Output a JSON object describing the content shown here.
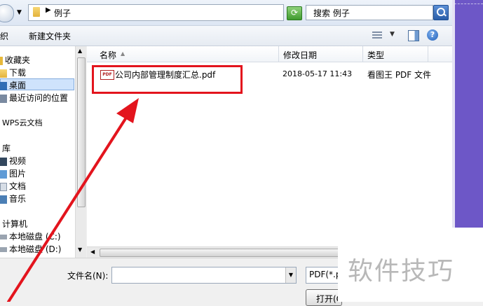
{
  "address": {
    "crumb": "例子",
    "search_placeholder": "搜索 例子"
  },
  "toolbar": {
    "organize_partial": "织",
    "new_folder": "新建文件夹"
  },
  "nav": {
    "items": [
      {
        "label": "收藏夹",
        "icon": "favorites-star-icon"
      },
      {
        "label": "下载",
        "icon": "download-folder-icon"
      },
      {
        "label": "桌面",
        "icon": "desktop-icon"
      },
      {
        "label": "最近访问的位置",
        "icon": "recent-places-icon"
      },
      {
        "label": "WPS云文档",
        "icon": "cloud-icon"
      },
      {
        "label": "库",
        "icon": "library-icon"
      },
      {
        "label": "视频",
        "icon": "video-icon"
      },
      {
        "label": "图片",
        "icon": "picture-icon"
      },
      {
        "label": "文档",
        "icon": "document-icon"
      },
      {
        "label": "音乐",
        "icon": "music-icon"
      },
      {
        "label": "计算机",
        "icon": "computer-icon"
      },
      {
        "label": "本地磁盘 (C:)",
        "icon": "disk-icon"
      },
      {
        "label": "本地磁盘 (D:)",
        "icon": "disk-icon"
      }
    ]
  },
  "columns": {
    "name": "名称",
    "modified": "修改日期",
    "type": "类型"
  },
  "files": [
    {
      "name": "公司内部管理制度汇总.pdf",
      "modified": "2018-05-17 11:43",
      "type": "看图王 PDF 文件",
      "icon_text": "PDF"
    }
  ],
  "bottom": {
    "filename_label": "文件名(N):",
    "filename_value": "",
    "filter": "PDF(*.p",
    "open_button": "打开(O"
  },
  "watermark": "软件技巧",
  "colors": {
    "highlight_box": "#e3141d",
    "arrow": "#e3141d",
    "purple_bg": "#6d57c7"
  }
}
